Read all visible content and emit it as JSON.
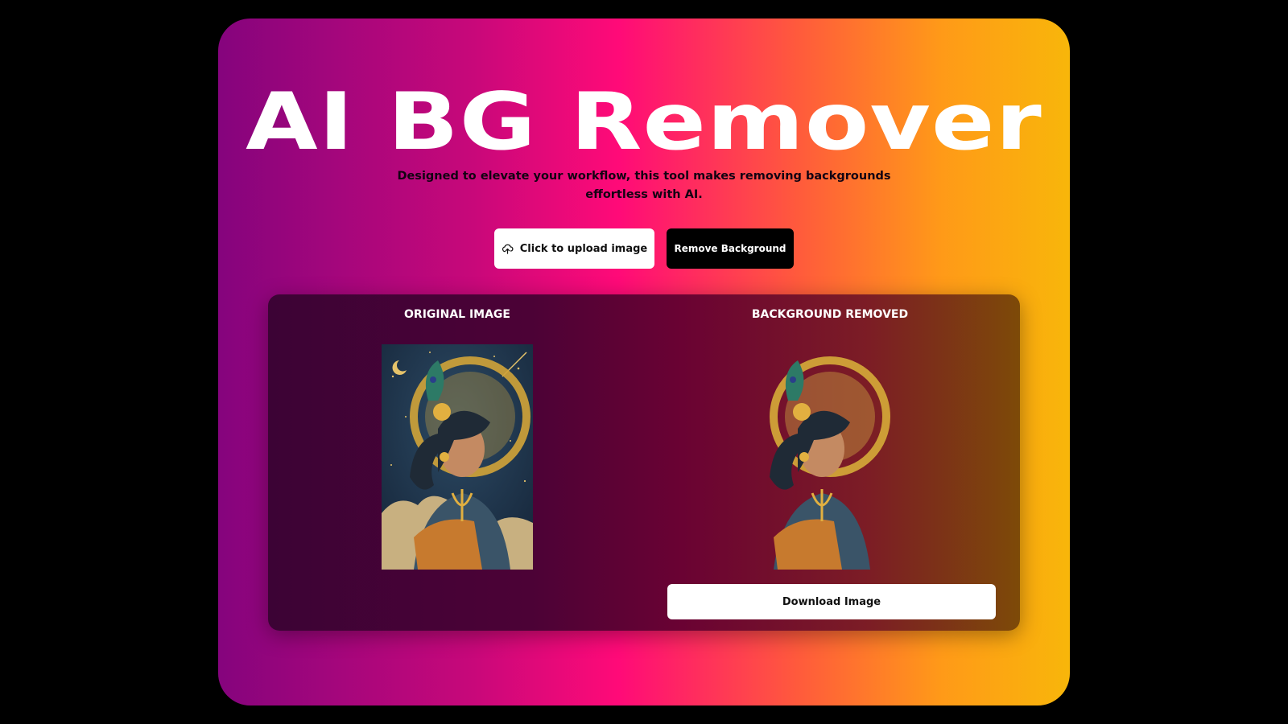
{
  "header": {
    "title": "AI BG Remover",
    "subtitle_line1": "Designed to elevate your workflow, this tool makes removing backgrounds",
    "subtitle_line2": "effortless with AI."
  },
  "actions": {
    "upload_label": "Click to upload image",
    "remove_label": "Remove Background"
  },
  "results": {
    "original_heading": "ORIGINAL IMAGE",
    "removed_heading": "BACKGROUND REMOVED",
    "download_label": "Download Image"
  },
  "colors": {
    "gradient_start": "#85047d",
    "gradient_mid": "#ff0a78",
    "gradient_end": "#f8b60a",
    "panel_start": "#3c0335",
    "panel_end": "#7d4a08"
  },
  "icons": {
    "upload": "cloud-upload-icon"
  }
}
